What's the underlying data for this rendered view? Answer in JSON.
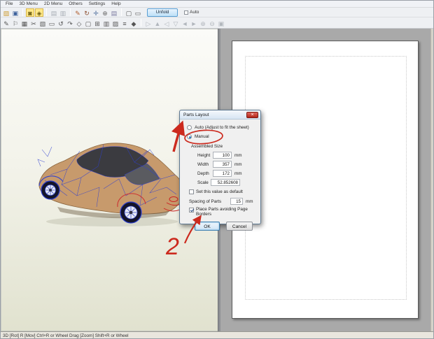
{
  "menu": {
    "items": [
      "File",
      "3D Menu",
      "2D Menu",
      "Others",
      "Settings",
      "Help"
    ]
  },
  "toolbar_top": {
    "unfold": "Unfold",
    "auto": "Auto"
  },
  "icons": {
    "t1": [
      "▨",
      "▣",
      "◙",
      "◈",
      "▤",
      "▥",
      "✎",
      "↻",
      "✛",
      "⊕",
      "▤",
      "▢",
      "▭"
    ],
    "t2_active": [
      "✎",
      "⚐",
      "▦",
      "✂",
      "▧",
      "▭",
      "↺",
      "↷",
      "◇",
      "▢",
      "⊞",
      "▥",
      "▨",
      "≡",
      "◆"
    ],
    "t2_gray": [
      "▷",
      "▲",
      "◁",
      "▽",
      "◄",
      "►",
      "⊕",
      "⊖",
      "▣"
    ],
    "close": "×"
  },
  "dialog": {
    "title": "Parts Layout",
    "radio_auto": "Auto (Adjust to fit the sheet)",
    "radio_manual": "Manual",
    "group_label": "Assembled Size",
    "fields": [
      {
        "label": "Height",
        "value": "100",
        "unit": "mm"
      },
      {
        "label": "Width",
        "value": "357",
        "unit": "mm"
      },
      {
        "label": "Depth",
        "value": "172",
        "unit": "mm"
      },
      {
        "label": "Scale",
        "value": "52.852608",
        "unit": ""
      }
    ],
    "checkbox_default": "Set this value as default",
    "spacing_label": "Spacing of Parts",
    "spacing_value": "15",
    "spacing_unit": "mm",
    "checkbox_borders": "Place Parts avoiding Page Borders",
    "ok_label": "OK",
    "cancel_label": "Cancel"
  },
  "annotations": {
    "step_two": "2"
  },
  "status": {
    "text": "3D [Rot] R [Mov] Ctrl+R or Wheel Drag [Zoom] Shift+R or Wheel"
  }
}
